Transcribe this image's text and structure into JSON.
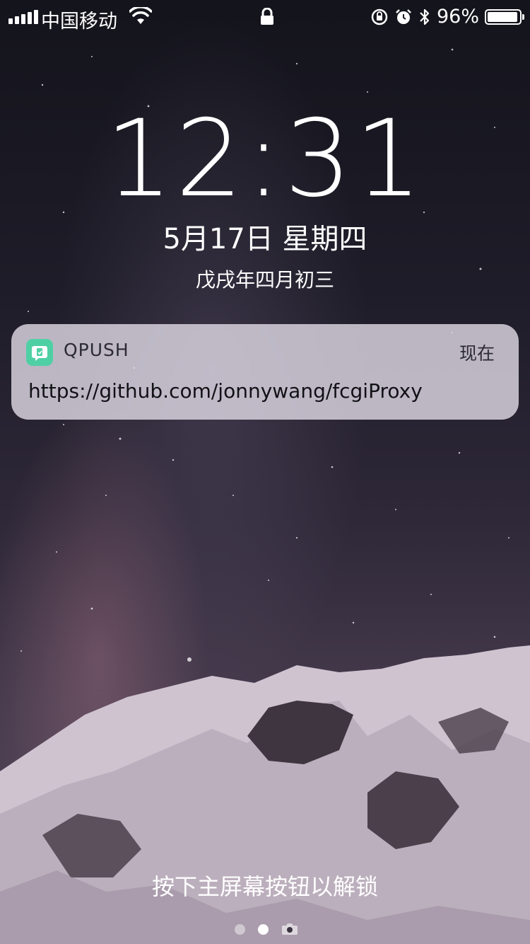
{
  "status_bar": {
    "carrier": "中国移动",
    "battery_percent_label": "96%",
    "battery_level": 0.96,
    "icons": [
      "signal-icon",
      "wifi-icon",
      "lock-icon",
      "orientation-lock-icon",
      "alarm-icon",
      "bluetooth-icon",
      "battery-icon"
    ]
  },
  "lockscreen": {
    "time": "12:31",
    "date": "5月17日 星期四",
    "lunar_date": "戊戌年四月初三",
    "unlock_hint": "按下主屏幕按钮以解锁"
  },
  "notification": {
    "app_name": "QPUSH",
    "time": "现在",
    "body": "https://github.com/jonnywang/fcgiProxy",
    "icon": "qpush-app-icon",
    "icon_color": "#4fd0a4"
  },
  "page_indicator": {
    "count": 2,
    "active_index": 1,
    "trailing_icon": "camera-icon"
  }
}
